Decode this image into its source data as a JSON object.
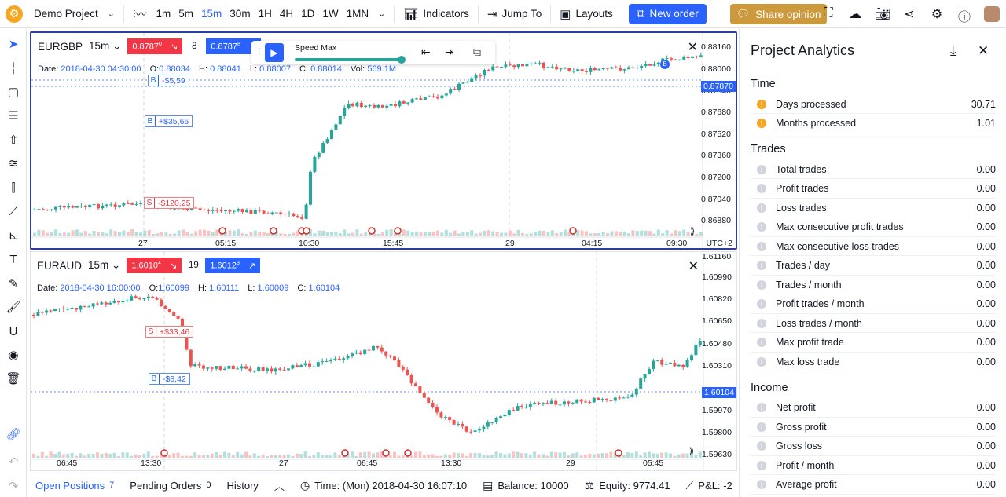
{
  "topbar": {
    "project": "Demo Project",
    "timeframes": [
      "1m",
      "5m",
      "15m",
      "30m",
      "1H",
      "4H",
      "1D",
      "1W",
      "1MN"
    ],
    "active_timeframe": "15m",
    "indicators": "Indicators",
    "jump_to": "Jump To",
    "layouts": "Layouts",
    "new_order": "New order",
    "share_opinion": "Share opinion"
  },
  "speed": {
    "label": "Speed Max",
    "level": 1.0
  },
  "pane1": {
    "symbol": "EURGBP",
    "timeframe": "15m",
    "sell": "0.8787",
    "sell_sup": "0",
    "qty": "8",
    "buy": "0.8787",
    "buy_sup": "8",
    "ohlc": {
      "date_label": "Date:",
      "date": "2018-04-30 04:30:00",
      "o_label": "O:",
      "o": "0.88034",
      "h_label": "H:",
      "h": "0.88041",
      "l_label": "L:",
      "l": "0.88007",
      "c_label": "C:",
      "c": "0.88014",
      "vol_label": "Vol:",
      "vol": "569.1M"
    },
    "price_axis": [
      "0.88160",
      "0.88000",
      "0.87840",
      "0.87680",
      "0.87520",
      "0.87360",
      "0.87200",
      "0.87040",
      "0.86880"
    ],
    "current_price": "0.87870",
    "time_axis": [
      "27",
      "05:15",
      "10:30",
      "15:45",
      "29",
      "04:15",
      "09:30"
    ],
    "utc": "UTC+2",
    "trades": [
      {
        "side": "B",
        "label": "-$5,59"
      },
      {
        "side": "B",
        "label": "+$35,66"
      },
      {
        "side": "S",
        "label": "-$120,25"
      }
    ],
    "marker": "B"
  },
  "pane2": {
    "symbol": "EURAUD",
    "timeframe": "15m",
    "sell": "1.6010",
    "sell_sup": "4",
    "qty": "19",
    "buy": "1.6012",
    "buy_sup": "3",
    "ohlc": {
      "date_label": "Date:",
      "date": "2018-04-30 16:00:00",
      "o_label": "O:",
      "o": "1.60099",
      "h_label": "H:",
      "h": "1.60111",
      "l_label": "L:",
      "l": "1.60009",
      "c_label": "C:",
      "c": "1.60104"
    },
    "price_axis": [
      "1.61160",
      "1.60990",
      "1.60820",
      "1.60650",
      "1.60480",
      "1.60310",
      "1.59970",
      "1.59800",
      "1.59630"
    ],
    "current_price": "1.60104",
    "time_axis": [
      "06:45",
      "13:30",
      "27",
      "06:45",
      "13:30",
      "29",
      "05:45"
    ],
    "trades": [
      {
        "side": "S",
        "label": "+$33,46"
      },
      {
        "side": "B",
        "label": "-$8,42"
      }
    ]
  },
  "bottombar": {
    "open_positions": "Open Positions",
    "open_count": "7",
    "pending_orders": "Pending Orders",
    "pending_count": "0",
    "history": "History",
    "time": "Time: (Mon) 2018-04-30 16:07:10",
    "balance": "Balance: 10000",
    "equity": "Equity: 9774.41",
    "pnl": "P&L: -2"
  },
  "analytics": {
    "title": "Project Analytics",
    "sections": [
      {
        "title": "Time",
        "rows": [
          {
            "name": "Days processed",
            "value": "30.71",
            "warn": true
          },
          {
            "name": "Months processed",
            "value": "1.01",
            "warn": true
          }
        ]
      },
      {
        "title": "Trades",
        "rows": [
          {
            "name": "Total trades",
            "value": "0.00"
          },
          {
            "name": "Profit trades",
            "value": "0.00"
          },
          {
            "name": "Loss trades",
            "value": "0.00"
          },
          {
            "name": "Max consecutive profit trades",
            "value": "0.00"
          },
          {
            "name": "Max consecutive loss trades",
            "value": "0.00"
          },
          {
            "name": "Trades / day",
            "value": "0.00"
          },
          {
            "name": "Trades / month",
            "value": "0.00"
          },
          {
            "name": "Profit trades / month",
            "value": "0.00"
          },
          {
            "name": "Loss trades / month",
            "value": "0.00"
          },
          {
            "name": "Max profit trade",
            "value": "0.00"
          },
          {
            "name": "Max loss trade",
            "value": "0.00"
          }
        ]
      },
      {
        "title": "Income",
        "rows": [
          {
            "name": "Net profit",
            "value": "0.00"
          },
          {
            "name": "Gross profit",
            "value": "0.00"
          },
          {
            "name": "Gross loss",
            "value": "0.00"
          },
          {
            "name": "Profit / month",
            "value": "0.00"
          },
          {
            "name": "Average profit",
            "value": "0.00"
          }
        ]
      }
    ]
  },
  "colors": {
    "up": "#26a69a",
    "down": "#ef5350",
    "accent": "#2962ff",
    "sell": "#f23645",
    "brand": "#f5a623"
  }
}
